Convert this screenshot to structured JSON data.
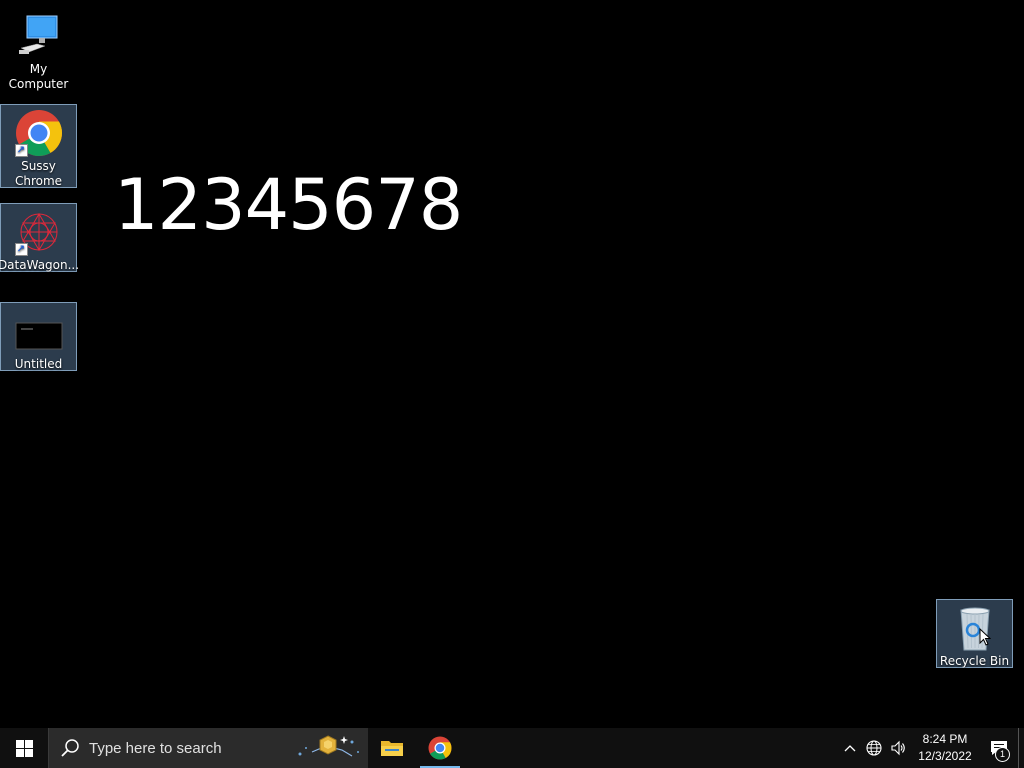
{
  "desktop": {
    "icons": [
      {
        "label": "My Computer",
        "icon": "computer-icon"
      },
      {
        "label": "Sussy\nChrome",
        "icon": "chrome-icon"
      },
      {
        "label": "DataWagon...",
        "icon": "datawagon-icon"
      },
      {
        "label": "Untitled",
        "icon": "untitled-thumbnail-icon"
      },
      {
        "label": "Recycle Bin",
        "icon": "recycle-bin-icon"
      }
    ],
    "wallpaper_text": "12345678"
  },
  "taskbar": {
    "search_placeholder": "Type here to search",
    "pinned": [
      {
        "name": "File Explorer",
        "icon": "folder-icon"
      },
      {
        "name": "Chrome",
        "icon": "chrome-icon",
        "active": true
      }
    ],
    "clock": {
      "time": "8:24 PM",
      "date": "12/3/2022"
    },
    "notifications_count": "1"
  },
  "colors": {
    "desktop_background": "#000000",
    "taskbar": "#101010",
    "search_box": "#2b2b2b",
    "selection": "#7f9db9",
    "active_indicator": "#76b9ed"
  }
}
